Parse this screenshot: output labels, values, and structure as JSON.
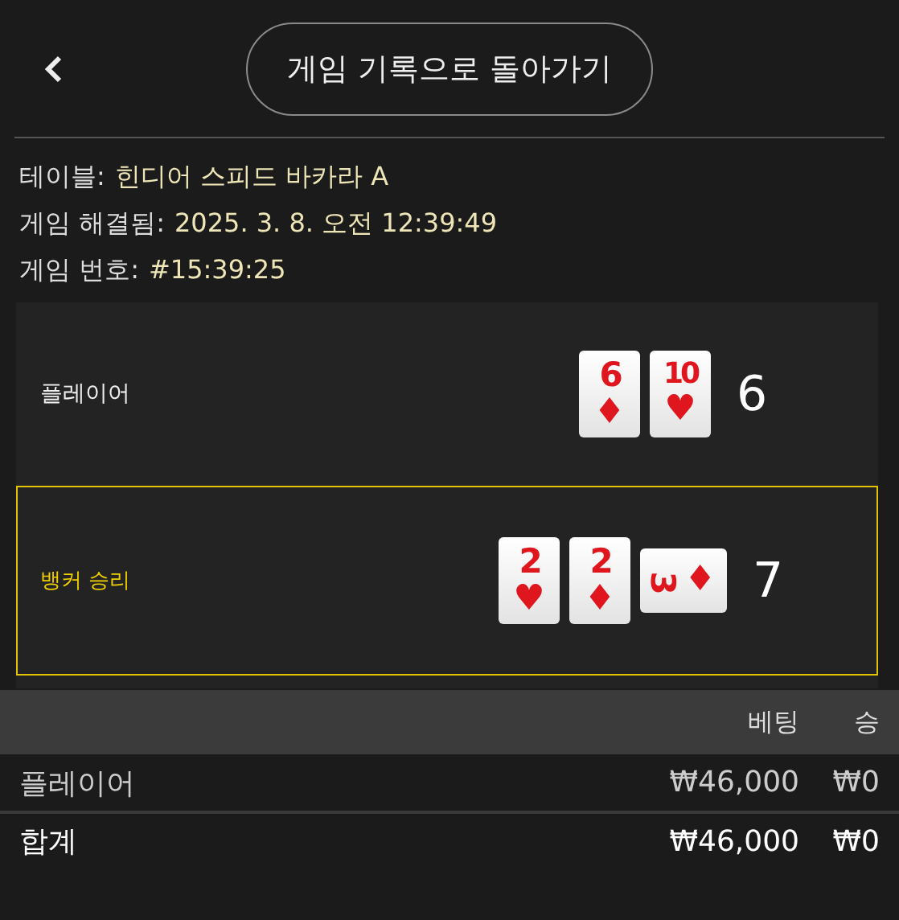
{
  "header": {
    "button": "게임 기록으로 돌아가기"
  },
  "info": [
    {
      "label": "테이블:",
      "value": "힌디어 스피드 바카라 A"
    },
    {
      "label": "게임 해결됨:",
      "value": "2025. 3. 8. 오전 12:39:49"
    },
    {
      "label": "게임 번호:",
      "value": "#15:39:25"
    }
  ],
  "hands": [
    {
      "label": "플레이어",
      "winner": false,
      "total": "6",
      "cards": [
        {
          "rank": "6",
          "suit": "♦",
          "kind": "upright"
        },
        {
          "rank": "10",
          "suit": "♥",
          "kind": "upright"
        }
      ]
    },
    {
      "label": "뱅커 승리",
      "winner": true,
      "total": "7",
      "cards": [
        {
          "rank": "2",
          "suit": "♥",
          "kind": "upright"
        },
        {
          "rank": "2",
          "suit": "♦",
          "kind": "upright"
        },
        {
          "rank": "3",
          "suit": "♦",
          "kind": "sideways"
        }
      ]
    }
  ],
  "table": {
    "columns": [
      "베팅",
      "승"
    ],
    "rows": [
      {
        "label": "플레이어",
        "cells": [
          "₩46,000",
          "₩0"
        ],
        "kind": "bet"
      },
      {
        "label": "합계",
        "cells": [
          "₩46,000",
          "₩0"
        ],
        "kind": "total"
      }
    ]
  }
}
